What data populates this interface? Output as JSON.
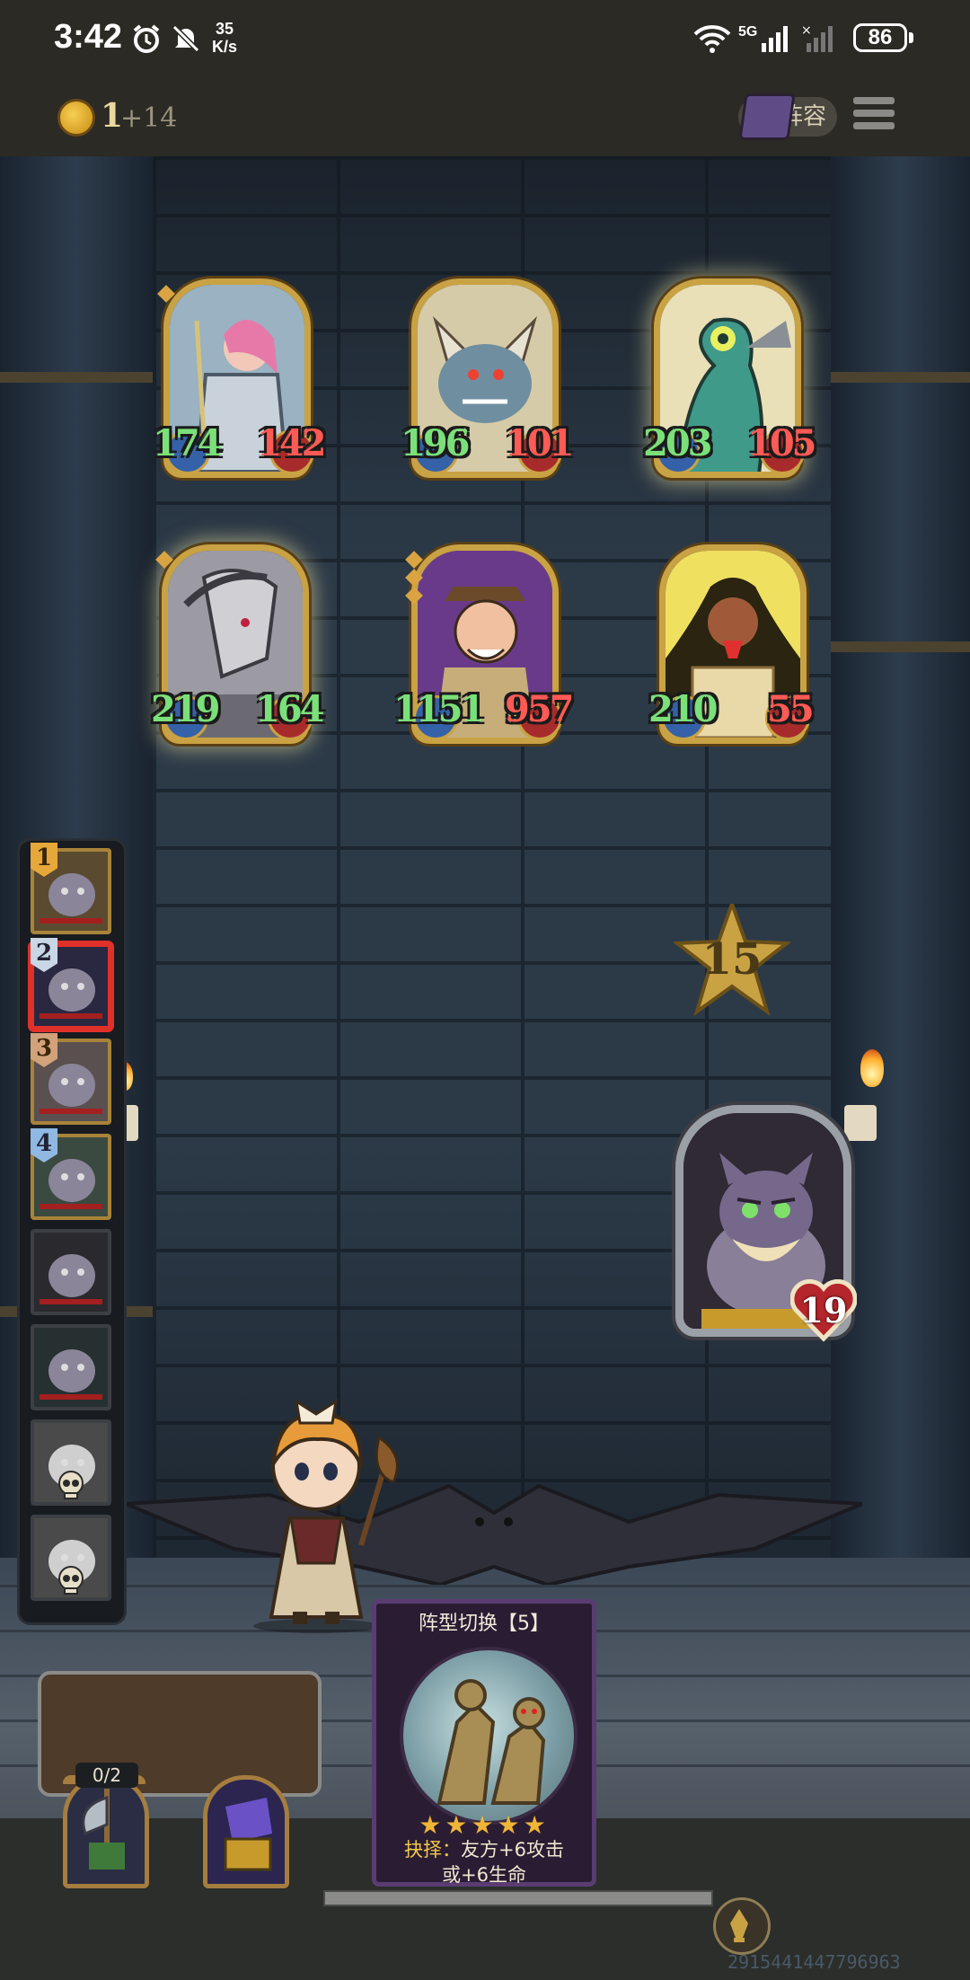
{
  "status_bar": {
    "time": "3:42",
    "net_speed_value": "35",
    "net_speed_unit": "K/s",
    "network_label": "5G",
    "battery": "86",
    "icons": [
      "alarm-icon",
      "mute-icon",
      "wifi-icon",
      "signal-icon",
      "battery-icon"
    ]
  },
  "top_bar": {
    "gold": "1",
    "gold_income": "+14",
    "lineup_label": "阵容"
  },
  "enemies": [
    {
      "name": "armored-knight",
      "attack": "174",
      "health": "142",
      "health_state": "damaged"
    },
    {
      "name": "horned-demon",
      "attack": "196",
      "health": "101",
      "health_state": "damaged"
    },
    {
      "name": "serpent-beast",
      "attack": "203",
      "health": "105",
      "health_state": "damaged"
    },
    {
      "name": "dragon-skull",
      "attack": "219",
      "health": "164",
      "health_state": "full"
    },
    {
      "name": "explorer",
      "attack": "1151",
      "health": "957",
      "health_state": "damaged"
    },
    {
      "name": "pharaoh",
      "attack": "210",
      "health": "55",
      "health_state": "damaged"
    }
  ],
  "turn_counter": "15",
  "hero": {
    "name": "cat-beast",
    "health": "19"
  },
  "queue": [
    {
      "number": "1",
      "badge": "gold",
      "state": "normal"
    },
    {
      "number": "2",
      "badge": "silver",
      "state": "active"
    },
    {
      "number": "3",
      "badge": "bronze",
      "state": "normal"
    },
    {
      "number": "4",
      "badge": "blue",
      "state": "normal"
    },
    {
      "number": "",
      "badge": "",
      "state": "plain"
    },
    {
      "number": "",
      "badge": "",
      "state": "plain"
    },
    {
      "number": "",
      "badge": "",
      "state": "dead"
    },
    {
      "number": "",
      "badge": "",
      "state": "dead"
    }
  ],
  "skill_card": {
    "title": "阵型切换【5】",
    "stars": "★★★★★",
    "rating": 5,
    "desc_prefix": "抉择：",
    "desc_line1": "友方+6攻击",
    "desc_line2": "或+6生命"
  },
  "tray": {
    "count": "0/2"
  },
  "seed_text": "2915441447796963",
  "colors": {
    "attack_green": "#7be07a",
    "health_red": "#ff5a55",
    "card_gold": "#c9a244",
    "wall": "#2c3a48"
  }
}
